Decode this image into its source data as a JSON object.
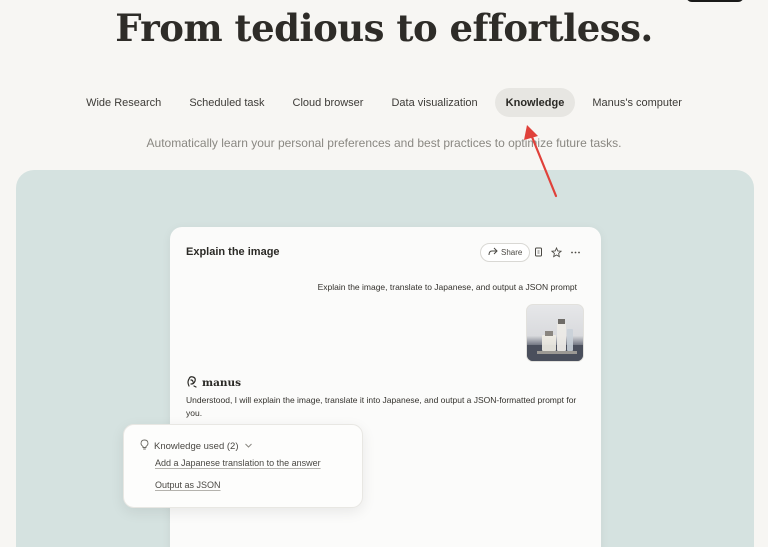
{
  "hero": {
    "title": "From tedious to effortless."
  },
  "tabs": [
    {
      "label": "Wide Research",
      "active": false
    },
    {
      "label": "Scheduled task",
      "active": false
    },
    {
      "label": "Cloud browser",
      "active": false
    },
    {
      "label": "Data visualization",
      "active": false
    },
    {
      "label": "Knowledge",
      "active": true
    },
    {
      "label": "Manus's computer",
      "active": false
    }
  ],
  "subtitle": "Automatically learn your personal preferences and best practices to optimize future tasks.",
  "card": {
    "title": "Explain the image",
    "share_label": "Share",
    "user_message": "Explain the image, translate to Japanese, and output a JSON prompt",
    "brand_name": "manus",
    "reply": "Understood, I will explain the image, translate it into Japanese, and output a JSON-formatted prompt for you."
  },
  "knowledge": {
    "header": "Knowledge used (2)",
    "items": [
      "Add a Japanese translation to the answer",
      "Output as JSON"
    ]
  },
  "colors": {
    "background": "#f7f6f3",
    "panel": "#d5e2e0",
    "arrow": "#e0413a",
    "active_tab": "#e7e6e2"
  },
  "icons": [
    "share-icon",
    "copy-icon",
    "star-icon",
    "more-icon",
    "manus-logo-icon",
    "bulb-icon",
    "chevron-down-icon"
  ]
}
